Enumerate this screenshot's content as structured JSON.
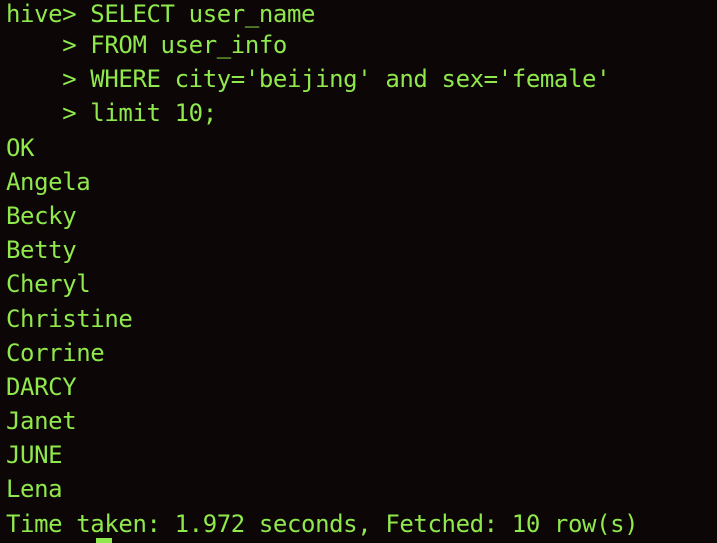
{
  "terminal": {
    "lines": [
      "hive> SELECT user_name",
      "    > FROM user_info",
      "    > WHERE city='beijing' and sex='female'",
      "    > limit 10;",
      "OK",
      "Angela",
      "Becky",
      "Betty",
      "Cheryl",
      "Christine",
      "Corrine",
      "DARCY",
      "Janet",
      "JUNE",
      "Lena",
      "Time taken: 1.972 seconds, Fetched: 10 row(s)"
    ]
  },
  "colors": {
    "background": "#0d0606",
    "text": "#8fe84c"
  }
}
